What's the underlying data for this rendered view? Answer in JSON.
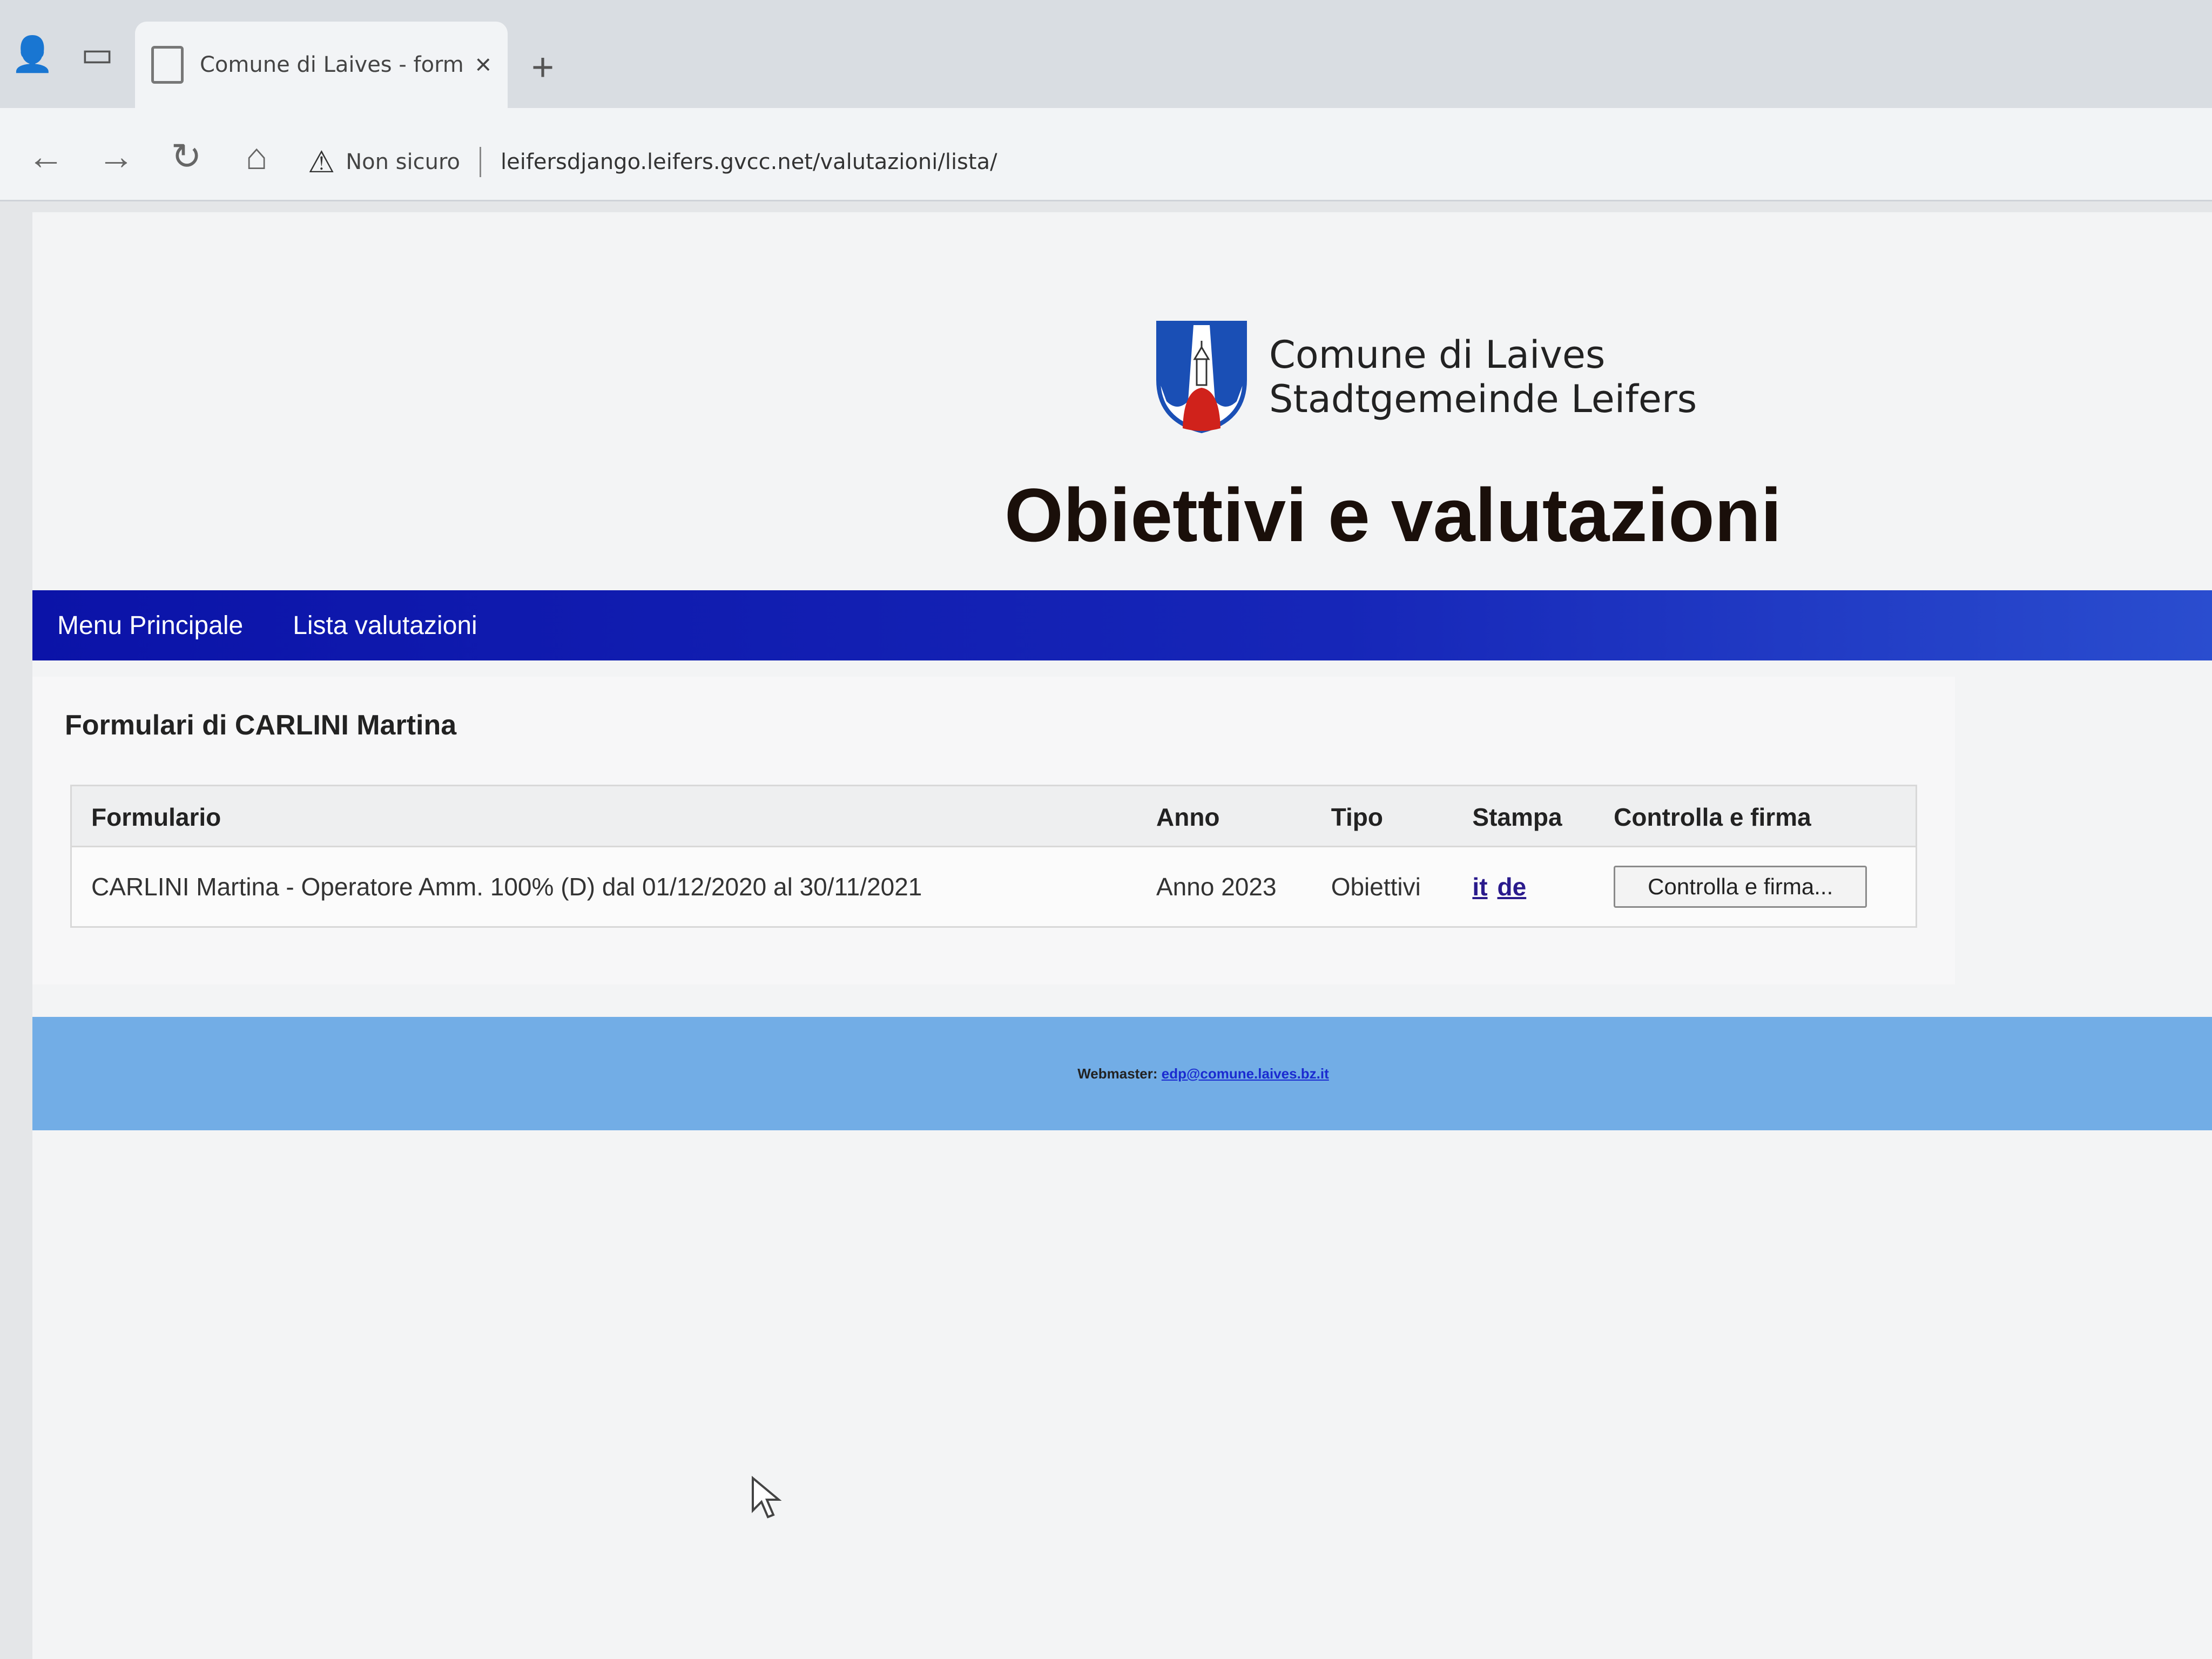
{
  "browser": {
    "tab_title": "Comune di Laives - formulario p",
    "tab_close": "×",
    "new_tab": "+",
    "security_label": "Non sicuro",
    "url": "leifersdjango.leifers.gvcc.net/valutazioni/lista/",
    "icons": {
      "back": "←",
      "forward": "→",
      "reload": "↻",
      "home": "⌂",
      "warning": "⚠",
      "profile": "👤",
      "tab_actions": "▭"
    }
  },
  "header": {
    "org_name_it": "Comune di Laives",
    "org_name_de": "Stadtgemeinde Leifers",
    "app_title": "Obiettivi e valutazioni"
  },
  "navbar": {
    "items": [
      {
        "label": "Menu Principale"
      },
      {
        "label": "Lista valutazioni"
      }
    ]
  },
  "content": {
    "title": "Formulari di CARLINI Martina",
    "table": {
      "headers": {
        "formulario": "Formulario",
        "anno": "Anno",
        "tipo": "Tipo",
        "stampa": "Stampa",
        "controlla": "Controlla e firma"
      },
      "rows": [
        {
          "formulario": "CARLINI Martina - Operatore Amm. 100% (D) dal 01/12/2020 al 30/11/2021",
          "anno": "Anno 2023",
          "tipo": "Obiettivi",
          "print_it": "it",
          "print_de": "de",
          "button": "Controlla e firma..."
        }
      ]
    }
  },
  "footer": {
    "label": "Webmaster:",
    "email": "edp@comune.laives.bz.it"
  },
  "colors": {
    "navbar": "#0b13a8",
    "footer": "#72ade6",
    "coat_blue": "#1a4fb5",
    "coat_red": "#d0221b"
  }
}
